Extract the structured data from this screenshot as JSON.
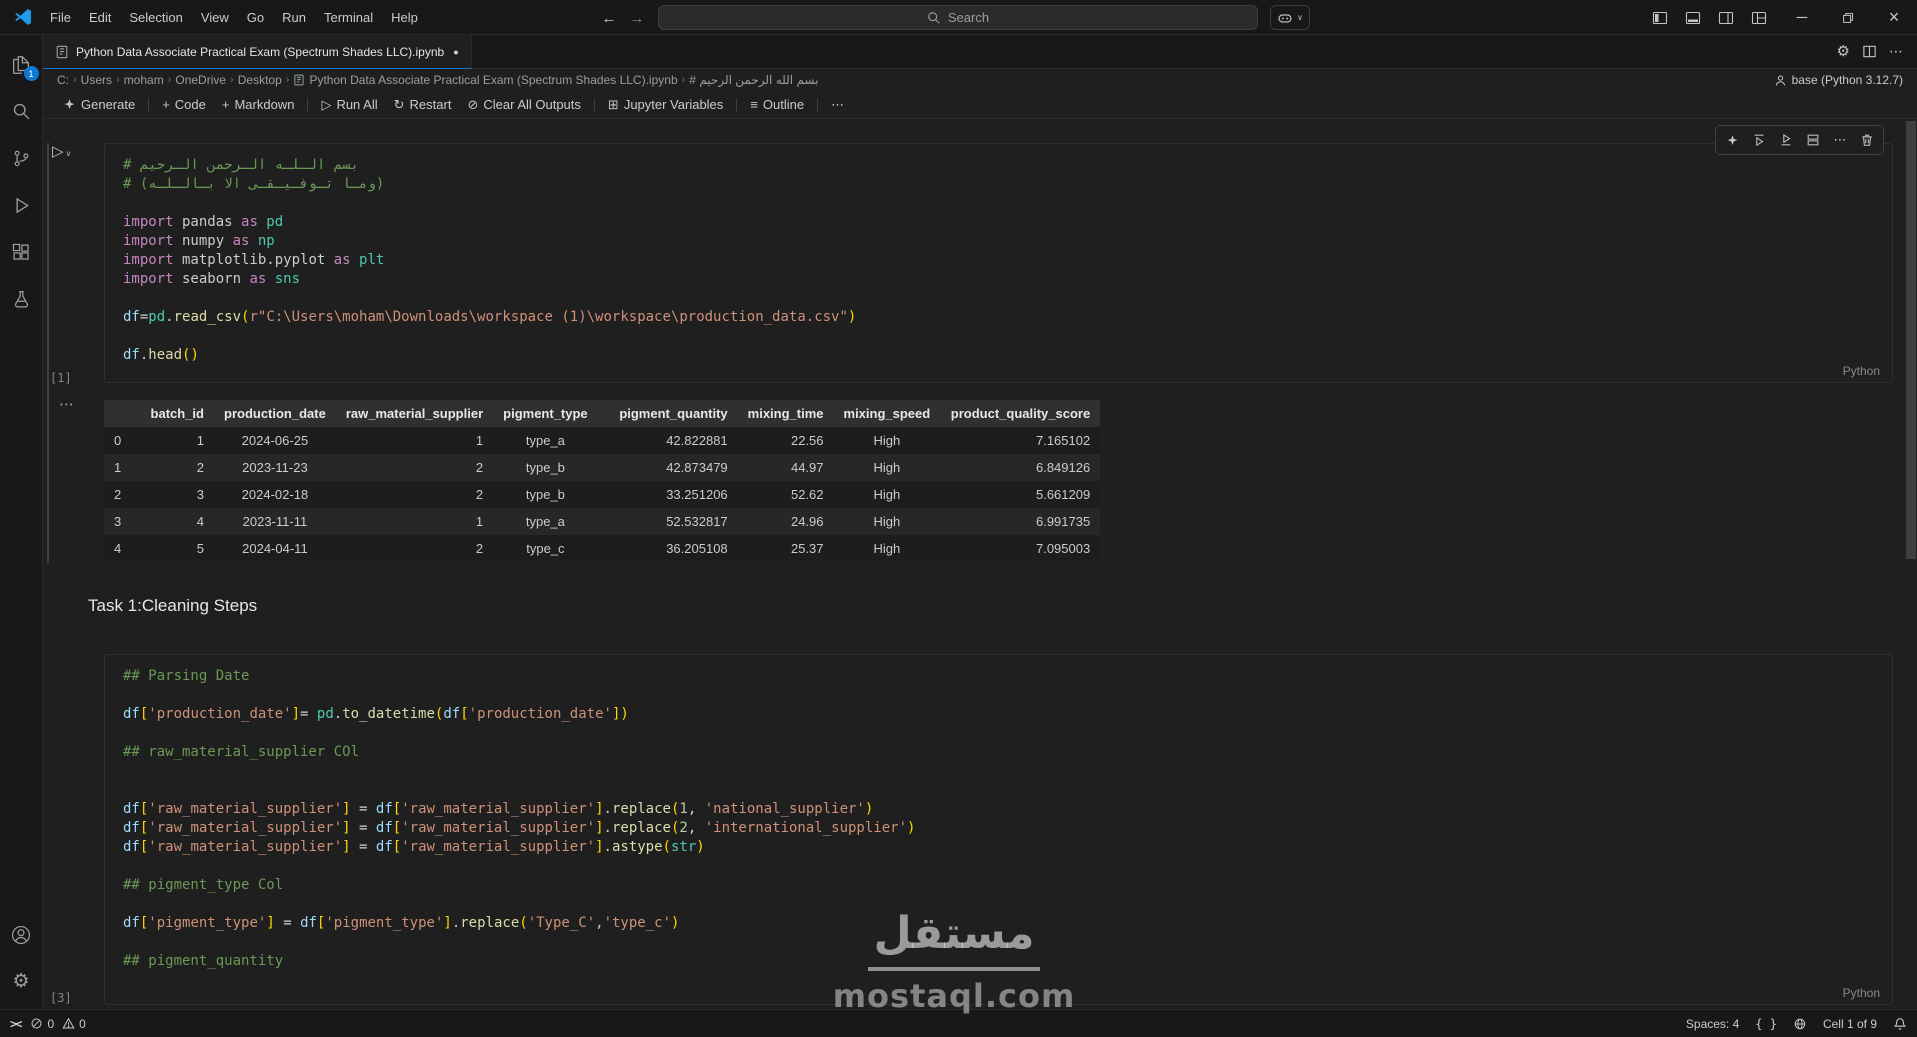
{
  "window": {
    "menus": [
      "File",
      "Edit",
      "Selection",
      "View",
      "Go",
      "Run",
      "Terminal",
      "Help"
    ],
    "search_placeholder": "Search"
  },
  "icons": {
    "back": "←",
    "forward": "→",
    "chevron_down": "∨",
    "gear": "⚙",
    "more": "⋯",
    "separator": "›",
    "modified_dot": "●",
    "minimize": "─",
    "close": "×",
    "plus": "+",
    "run": "▷",
    "restart": "↻",
    "clear": "⊘",
    "variables": "⊞",
    "outline": "≡",
    "remote": "><",
    "output_more": "⋯"
  },
  "tab": {
    "title": "Python Data Associate Practical Exam (Spectrum Shades LLC).ipynb"
  },
  "breadcrumbs": [
    "C:",
    "Users",
    "moham",
    "OneDrive",
    "Desktop",
    "Python Data Associate Practical Exam (Spectrum Shades LLC).ipynb",
    "# بسم الله الرحمن الرحيم"
  ],
  "kernel": {
    "label": "base (Python 3.12.7)"
  },
  "toolbar": {
    "generate": "Generate",
    "code": "Code",
    "markdown": "Markdown",
    "run_all": "Run All",
    "restart": "Restart",
    "clear_all_outputs": "Clear All Outputs",
    "jupyter_variables": "Jupyter Variables",
    "outline": "Outline"
  },
  "cells": {
    "cell1": {
      "exec": "[1]",
      "lang": "Python",
      "lines": [
        [
          [
            "cmt",
            "# بسم الـلـه الـرحمن الـرحيم"
          ]
        ],
        [
          [
            "cmt",
            "# (ومـا تـوفـيـقـى الا بـالـلـه)"
          ]
        ],
        [],
        [
          [
            "kw",
            "import"
          ],
          [
            "pl",
            " pandas "
          ],
          [
            "kw",
            "as"
          ],
          [
            "mod",
            " pd"
          ]
        ],
        [
          [
            "kw",
            "import"
          ],
          [
            "pl",
            " numpy "
          ],
          [
            "kw",
            "as"
          ],
          [
            "mod",
            " np"
          ]
        ],
        [
          [
            "kw",
            "import"
          ],
          [
            "pl",
            " matplotlib.pyplot "
          ],
          [
            "kw",
            "as"
          ],
          [
            "mod",
            " plt"
          ]
        ],
        [
          [
            "kw",
            "import"
          ],
          [
            "pl",
            " seaborn "
          ],
          [
            "kw",
            "as"
          ],
          [
            "mod",
            " sns"
          ]
        ],
        [],
        [
          [
            "var",
            "df"
          ],
          [
            "op",
            "="
          ],
          [
            "mod",
            "pd"
          ],
          [
            "pl",
            "."
          ],
          [
            "fn",
            "read_csv"
          ],
          [
            "br",
            "("
          ],
          [
            "str",
            "r\"C:\\Users\\moham\\Downloads\\workspace (1)\\workspace\\production_data.csv\""
          ],
          [
            "br",
            ")"
          ]
        ],
        [],
        [
          [
            "var",
            "df"
          ],
          [
            "pl",
            "."
          ],
          [
            "fn",
            "head"
          ],
          [
            "br",
            "()"
          ]
        ]
      ]
    },
    "output": {
      "table": {
        "columns": [
          "",
          "batch_id",
          "production_date",
          "raw_material_supplier",
          "pigment_type",
          "pigment_quantity",
          "mixing_time",
          "mixing_speed",
          "product_quality_score"
        ],
        "align": [
          "left",
          "right",
          "center",
          "right",
          "center",
          "right",
          "right",
          "center",
          "right"
        ],
        "widths": [
          36,
          74,
          118,
          155,
          100,
          140,
          88,
          98,
          160
        ],
        "rows": [
          [
            "0",
            "1",
            "2024-06-25",
            "1",
            "type_a",
            "42.822881",
            "22.56",
            "High",
            "7.165102"
          ],
          [
            "1",
            "2",
            "2023-11-23",
            "2",
            "type_b",
            "42.873479",
            "44.97",
            "High",
            "6.849126"
          ],
          [
            "2",
            "3",
            "2024-02-18",
            "2",
            "type_b",
            "33.251206",
            "52.62",
            "High",
            "5.661209"
          ],
          [
            "3",
            "4",
            "2023-11-11",
            "1",
            "type_a",
            "52.532817",
            "24.96",
            "High",
            "6.991735"
          ],
          [
            "4",
            "5",
            "2024-04-11",
            "2",
            "type_c",
            "36.205108",
            "25.37",
            "High",
            "7.095003"
          ]
        ]
      }
    },
    "markdown": {
      "text": "Task 1:Cleaning Steps"
    },
    "cell2": {
      "exec": "[3]",
      "lang": "Python",
      "lines": [
        [
          [
            "cmt",
            "## Parsing Date"
          ]
        ],
        [],
        [
          [
            "var",
            "df"
          ],
          [
            "br",
            "["
          ],
          [
            "str",
            "'production_date'"
          ],
          [
            "br",
            "]"
          ],
          [
            "op",
            "="
          ],
          [
            "pl",
            " "
          ],
          [
            "mod",
            "pd"
          ],
          [
            "pl",
            "."
          ],
          [
            "fn",
            "to_datetime"
          ],
          [
            "br",
            "("
          ],
          [
            "var",
            "df"
          ],
          [
            "br",
            "["
          ],
          [
            "str",
            "'production_date'"
          ],
          [
            "br",
            "]"
          ],
          [
            "br",
            ")"
          ]
        ],
        [],
        [
          [
            "cmt",
            "## raw_material_supplier COl"
          ]
        ],
        [],
        [],
        [
          [
            "var",
            "df"
          ],
          [
            "br",
            "["
          ],
          [
            "str",
            "'raw_material_supplier'"
          ],
          [
            "br",
            "]"
          ],
          [
            "pl",
            " "
          ],
          [
            "op",
            "="
          ],
          [
            "pl",
            " "
          ],
          [
            "var",
            "df"
          ],
          [
            "br",
            "["
          ],
          [
            "str",
            "'raw_material_supplier'"
          ],
          [
            "br",
            "]"
          ],
          [
            "pl",
            "."
          ],
          [
            "fn",
            "replace"
          ],
          [
            "br",
            "("
          ],
          [
            "num",
            "1"
          ],
          [
            "pl",
            ", "
          ],
          [
            "str",
            "'national_supplier'"
          ],
          [
            "br",
            ")"
          ]
        ],
        [
          [
            "var",
            "df"
          ],
          [
            "br",
            "["
          ],
          [
            "str",
            "'raw_material_supplier'"
          ],
          [
            "br",
            "]"
          ],
          [
            "pl",
            " "
          ],
          [
            "op",
            "="
          ],
          [
            "pl",
            " "
          ],
          [
            "var",
            "df"
          ],
          [
            "br",
            "["
          ],
          [
            "str",
            "'raw_material_supplier'"
          ],
          [
            "br",
            "]"
          ],
          [
            "pl",
            "."
          ],
          [
            "fn",
            "replace"
          ],
          [
            "br",
            "("
          ],
          [
            "num",
            "2"
          ],
          [
            "pl",
            ", "
          ],
          [
            "str",
            "'international_supplier'"
          ],
          [
            "br",
            ")"
          ]
        ],
        [
          [
            "var",
            "df"
          ],
          [
            "br",
            "["
          ],
          [
            "str",
            "'raw_material_supplier'"
          ],
          [
            "br",
            "]"
          ],
          [
            "pl",
            " "
          ],
          [
            "op",
            "="
          ],
          [
            "pl",
            " "
          ],
          [
            "var",
            "df"
          ],
          [
            "br",
            "["
          ],
          [
            "str",
            "'raw_material_supplier'"
          ],
          [
            "br",
            "]"
          ],
          [
            "pl",
            "."
          ],
          [
            "fn",
            "astype"
          ],
          [
            "br",
            "("
          ],
          [
            "mod",
            "str"
          ],
          [
            "br",
            ")"
          ]
        ],
        [],
        [
          [
            "cmt",
            "## pigment_type Col"
          ]
        ],
        [],
        [
          [
            "var",
            "df"
          ],
          [
            "br",
            "["
          ],
          [
            "str",
            "'pigment_type'"
          ],
          [
            "br",
            "]"
          ],
          [
            "pl",
            " "
          ],
          [
            "op",
            "="
          ],
          [
            "pl",
            " "
          ],
          [
            "var",
            "df"
          ],
          [
            "br",
            "["
          ],
          [
            "str",
            "'pigment_type'"
          ],
          [
            "br",
            "]"
          ],
          [
            "pl",
            "."
          ],
          [
            "fn",
            "replace"
          ],
          [
            "br",
            "("
          ],
          [
            "str",
            "'Type_C'"
          ],
          [
            "pl",
            ","
          ],
          [
            "str",
            "'type_c'"
          ],
          [
            "br",
            ")"
          ]
        ],
        [],
        [
          [
            "cmt",
            "## pigment_quantity"
          ]
        ]
      ]
    }
  },
  "status": {
    "errors": "0",
    "warnings": "0",
    "spaces": "Spaces: 4",
    "braces": "{ }",
    "cell": "Cell 1 of 9"
  },
  "watermark": {
    "arabic": "مستقل",
    "domain": "mostaql.com"
  }
}
